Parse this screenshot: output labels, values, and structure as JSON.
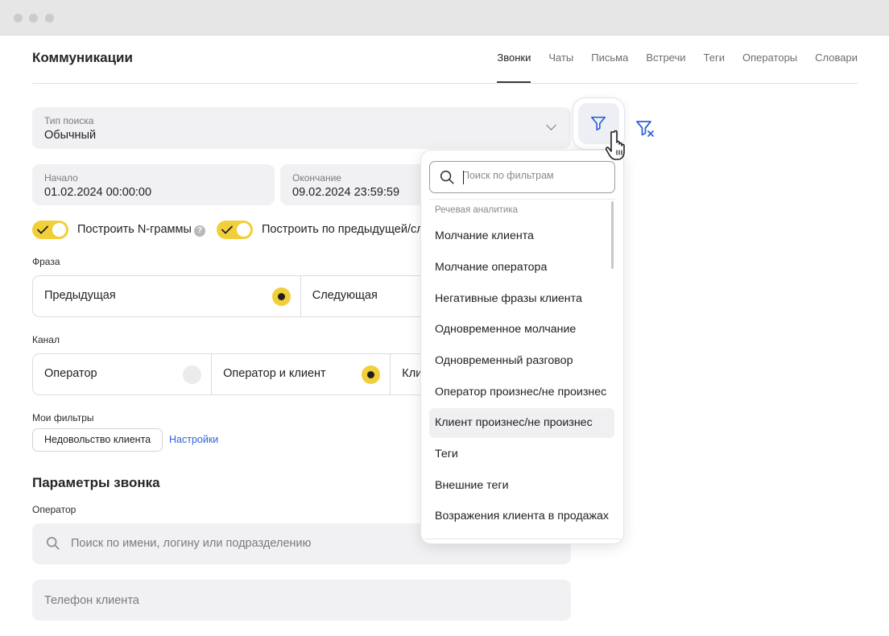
{
  "header": {
    "title": "Коммуникации",
    "tabs": [
      {
        "label": "Звонки",
        "active": true
      },
      {
        "label": "Чаты",
        "active": false
      },
      {
        "label": "Письма",
        "active": false
      },
      {
        "label": "Встречи",
        "active": false
      },
      {
        "label": "Теги",
        "active": false
      },
      {
        "label": "Операторы",
        "active": false
      },
      {
        "label": "Словари",
        "active": false
      }
    ]
  },
  "search_type": {
    "label": "Тип поиска",
    "value": "Обычный"
  },
  "dates": {
    "start": {
      "label": "Начало",
      "value": "01.02.2024 00:00:00"
    },
    "end": {
      "label": "Окончание",
      "value": "09.02.2024 23:59:59"
    }
  },
  "toggles": {
    "ngrams": {
      "label": "Построить N-граммы",
      "on": true
    },
    "prev_next": {
      "label": "Построить по предыдущей/сл",
      "on": true
    }
  },
  "phrase": {
    "label": "Фраза",
    "options": [
      {
        "label": "Предыдущая",
        "selected": true
      },
      {
        "label": "Следующая",
        "selected": false
      }
    ]
  },
  "channel": {
    "label": "Канал",
    "options": [
      {
        "label": "Оператор",
        "selected": false
      },
      {
        "label": "Оператор и клиент",
        "selected": true
      },
      {
        "label": "Кли",
        "selected": false
      }
    ]
  },
  "my_filters": {
    "label": "Мои фильтры",
    "chips": [
      "Недовольство клиента"
    ],
    "settings_link": "Настройки"
  },
  "call_params": {
    "title": "Параметры звонка",
    "operator_label": "Оператор",
    "operator_placeholder": "Поиск по имени, логину или подразделению",
    "phone_placeholder": "Телефон клиента"
  },
  "filter_dropdown": {
    "search_placeholder": "Поиск по фильтрам",
    "group": "Речевая аналитика",
    "items": [
      "Молчание клиента",
      "Молчание оператора",
      "Негативные фразы клиента",
      "Одновременное молчание",
      "Одновременный разговор",
      "Оператор произнес/не произнес",
      "Клиент произнес/не произнес",
      "Теги",
      "Внешние теги",
      "Возражения клиента в продажах"
    ],
    "highlighted_index": 6
  },
  "icons": {
    "filter": "filter-icon",
    "filter_clear": "filter-clear-icon",
    "search": "search-icon",
    "help": "help-icon",
    "chevron": "chevron-down-icon",
    "cursor": "hand-pointer-icon"
  },
  "colors": {
    "accent_yellow": "#f1cf3a",
    "link_blue": "#2f63d6",
    "field_bg": "#f1f1f3"
  }
}
